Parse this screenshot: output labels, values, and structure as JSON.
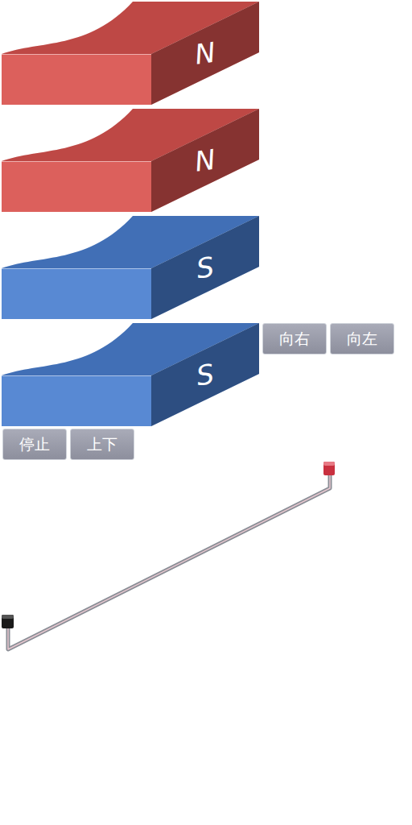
{
  "magnets": [
    {
      "pole": "N",
      "color": "#d9534f"
    },
    {
      "pole": "N",
      "color": "#d9534f"
    },
    {
      "pole": "S",
      "color": "#4a7fd0"
    },
    {
      "pole": "S",
      "color": "#4a7fd0"
    }
  ],
  "controls": {
    "direction_buttons": [
      "向右",
      "向左"
    ],
    "motion_buttons": [
      "停止",
      "上下"
    ]
  }
}
